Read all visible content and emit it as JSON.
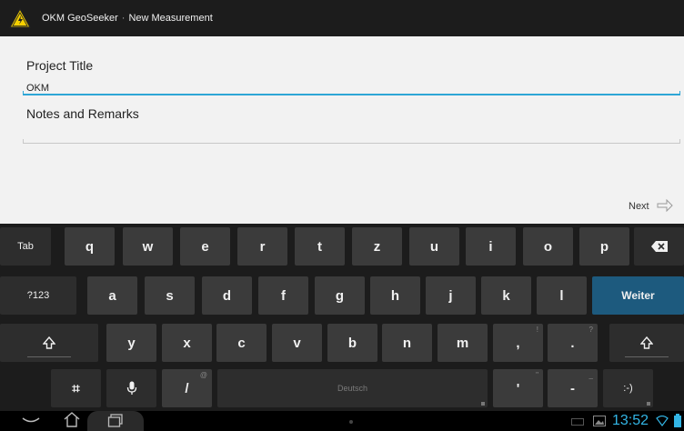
{
  "action_bar": {
    "app_name": "OKM GeoSeeker",
    "separator": "·",
    "screen_title": "New Measurement",
    "icon": "warning-logo-icon"
  },
  "form": {
    "project_title_label": "Project Title",
    "project_title_value": "OKM",
    "notes_label": "Notes and Remarks",
    "notes_value": "",
    "next_label": "Next",
    "accent_color": "#2ea6d6"
  },
  "keyboard": {
    "row1": [
      "Tab",
      "q",
      "w",
      "e",
      "r",
      "t",
      "z",
      "u",
      "i",
      "o",
      "p"
    ],
    "row2": [
      "?123",
      "a",
      "s",
      "d",
      "f",
      "g",
      "h",
      "j",
      "k",
      "l"
    ],
    "row2_action": "Weiter",
    "row3": [
      "y",
      "x",
      "c",
      "v",
      "b",
      "n",
      "m",
      ",",
      "."
    ],
    "row3_hints": [
      "!",
      "?"
    ],
    "row4": {
      "symbol_key": "⌗",
      "slash_key": "/",
      "slash_hint": "@",
      "space_label": "Deutsch",
      "apostrophe_key": "'",
      "apostrophe_hint": "\"",
      "dash_key": "-",
      "dash_hint": "_",
      "smiley_key": ":-)"
    },
    "action_color": "#1d5a7e"
  },
  "system_bar": {
    "time": "13:52",
    "clock_color": "#33b5e5"
  }
}
